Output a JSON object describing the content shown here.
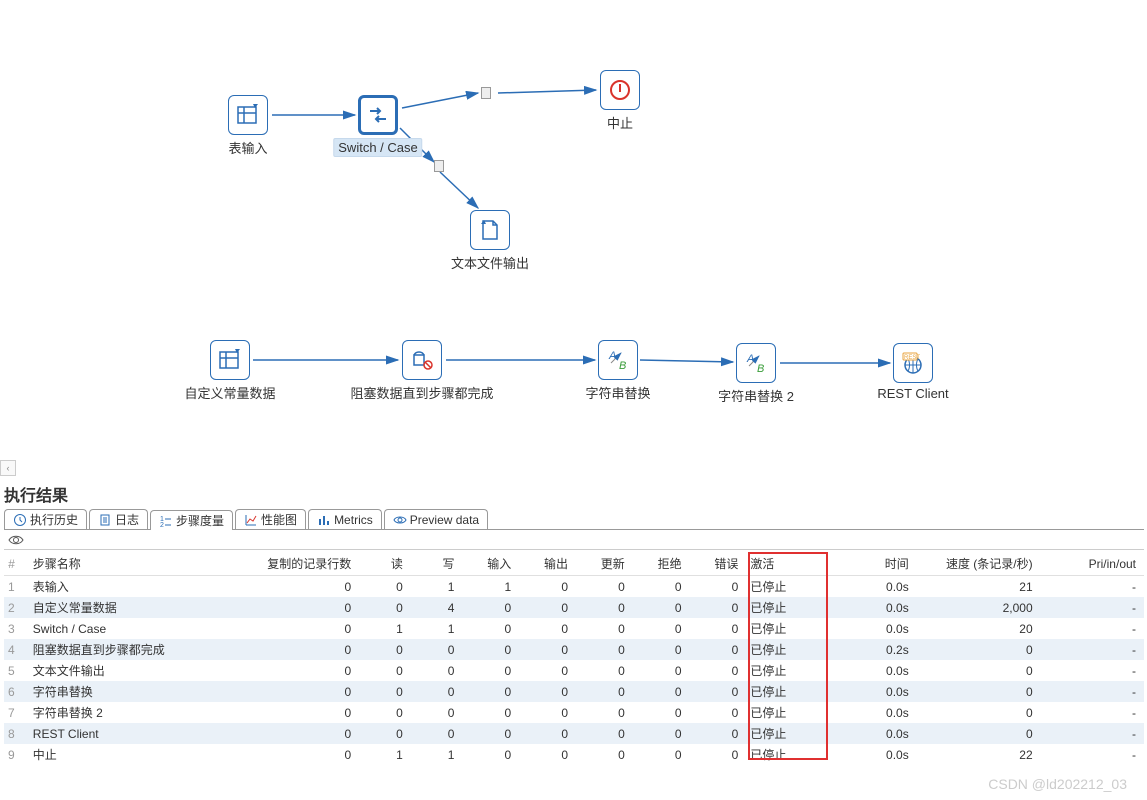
{
  "canvas": {
    "nodes": {
      "table_input": {
        "label": "表输入",
        "icon": "table-input-icon"
      },
      "switch_case": {
        "label": "Switch / Case",
        "icon": "switch-icon"
      },
      "abort": {
        "label": "中止",
        "icon": "abort-icon"
      },
      "text_out": {
        "label": "文本文件输出",
        "icon": "text-file-icon"
      },
      "const_data": {
        "label": "自定义常量数据",
        "icon": "table-input-icon"
      },
      "block_step": {
        "label": "阻塞数据直到步骤都完成",
        "icon": "block-icon"
      },
      "str_replace": {
        "label": "字符串替换",
        "icon": "replace-icon"
      },
      "str_replace2": {
        "label": "字符串替换 2",
        "icon": "replace-icon"
      },
      "rest_client": {
        "label": "REST Client",
        "icon": "rest-icon"
      }
    }
  },
  "results": {
    "title": "执行结果",
    "tabs": [
      "执行历史",
      "日志",
      "步骤度量",
      "性能图",
      "Metrics",
      "Preview data"
    ],
    "active_tab": 2,
    "columns": [
      "#",
      "步骤名称",
      "复制的记录行数",
      "读",
      "写",
      "输入",
      "输出",
      "更新",
      "拒绝",
      "错误",
      "激活",
      "时间",
      "速度 (条记录/秒)",
      "Pri/in/out"
    ],
    "rows": [
      {
        "n": "1",
        "name": "表输入",
        "copy": "0",
        "read": "0",
        "write": "1",
        "in": "1",
        "out": "0",
        "upd": "0",
        "rej": "0",
        "err": "0",
        "active": "已停止",
        "time": "0.0s",
        "speed": "21",
        "pio": "-"
      },
      {
        "n": "2",
        "name": "自定义常量数据",
        "copy": "0",
        "read": "0",
        "write": "4",
        "in": "0",
        "out": "0",
        "upd": "0",
        "rej": "0",
        "err": "0",
        "active": "已停止",
        "time": "0.0s",
        "speed": "2,000",
        "pio": "-"
      },
      {
        "n": "3",
        "name": "Switch / Case",
        "copy": "0",
        "read": "1",
        "write": "1",
        "in": "0",
        "out": "0",
        "upd": "0",
        "rej": "0",
        "err": "0",
        "active": "已停止",
        "time": "0.0s",
        "speed": "20",
        "pio": "-"
      },
      {
        "n": "4",
        "name": "阻塞数据直到步骤都完成",
        "copy": "0",
        "read": "0",
        "write": "0",
        "in": "0",
        "out": "0",
        "upd": "0",
        "rej": "0",
        "err": "0",
        "active": "已停止",
        "time": "0.2s",
        "speed": "0",
        "pio": "-"
      },
      {
        "n": "5",
        "name": "文本文件输出",
        "copy": "0",
        "read": "0",
        "write": "0",
        "in": "0",
        "out": "0",
        "upd": "0",
        "rej": "0",
        "err": "0",
        "active": "已停止",
        "time": "0.0s",
        "speed": "0",
        "pio": "-"
      },
      {
        "n": "6",
        "name": "字符串替换",
        "copy": "0",
        "read": "0",
        "write": "0",
        "in": "0",
        "out": "0",
        "upd": "0",
        "rej": "0",
        "err": "0",
        "active": "已停止",
        "time": "0.0s",
        "speed": "0",
        "pio": "-"
      },
      {
        "n": "7",
        "name": "字符串替换 2",
        "copy": "0",
        "read": "0",
        "write": "0",
        "in": "0",
        "out": "0",
        "upd": "0",
        "rej": "0",
        "err": "0",
        "active": "已停止",
        "time": "0.0s",
        "speed": "0",
        "pio": "-"
      },
      {
        "n": "8",
        "name": "REST Client",
        "copy": "0",
        "read": "0",
        "write": "0",
        "in": "0",
        "out": "0",
        "upd": "0",
        "rej": "0",
        "err": "0",
        "active": "已停止",
        "time": "0.0s",
        "speed": "0",
        "pio": "-"
      },
      {
        "n": "9",
        "name": "中止",
        "copy": "0",
        "read": "1",
        "write": "1",
        "in": "0",
        "out": "0",
        "upd": "0",
        "rej": "0",
        "err": "0",
        "active": "已停止",
        "time": "0.0s",
        "speed": "22",
        "pio": "-"
      }
    ]
  },
  "watermark": "CSDN @ld202212_03"
}
